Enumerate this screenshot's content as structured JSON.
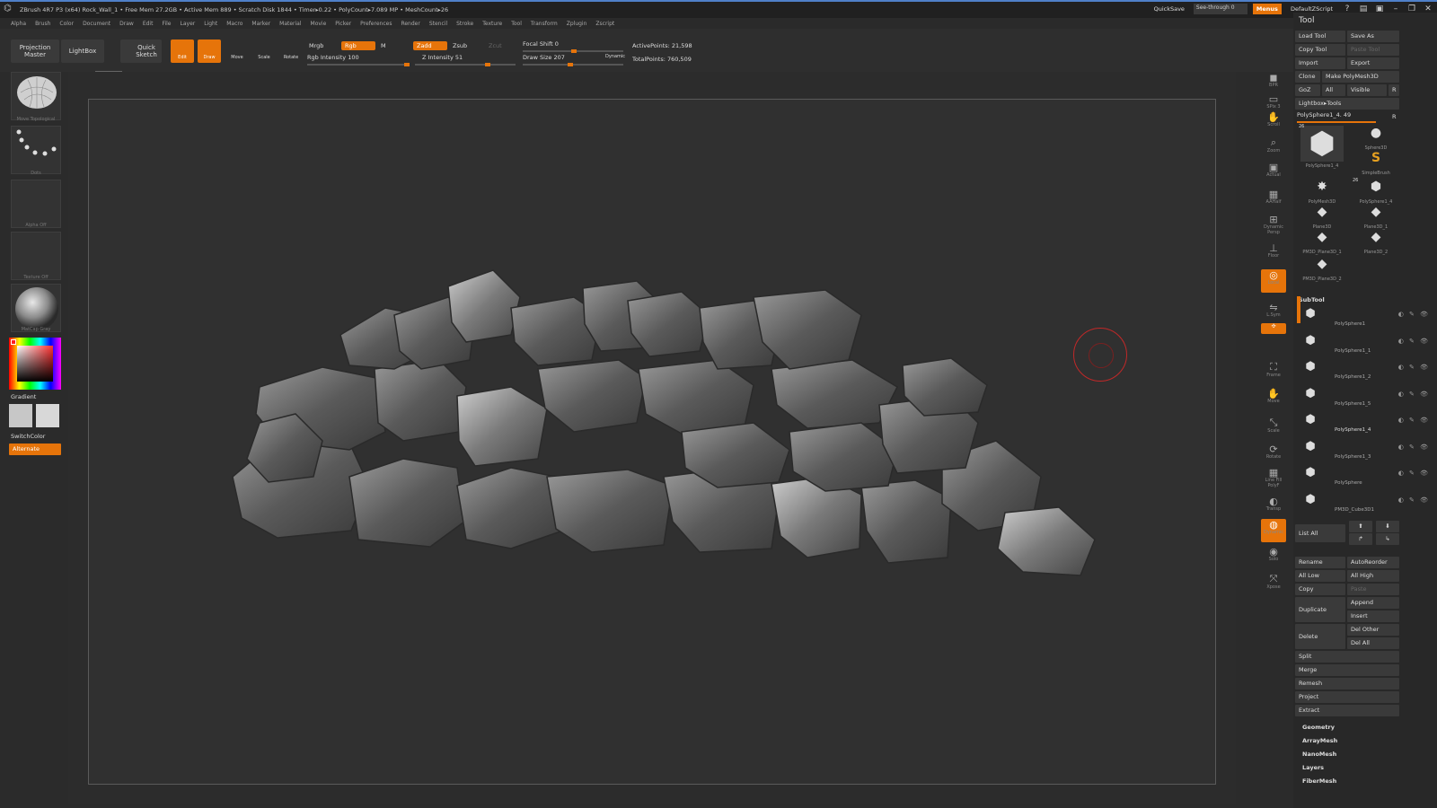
{
  "titlebar": {
    "logo_icon": "zbrush-logo-icon",
    "text": "ZBrush 4R7 P3 (x64)    Rock_Wall_1       • Free Mem 27.2GB • Active Mem 889 • Scratch Disk 1844 • Timer▸0.22 • PolyCount▸7.089 MP • MeshCount▸26",
    "quicksave": "QuickSave",
    "see_through": "See-through  0",
    "menus": "Menus",
    "default_zscript": "DefaultZScript"
  },
  "menus": [
    "Alpha",
    "Brush",
    "Color",
    "Document",
    "Draw",
    "Edit",
    "File",
    "Layer",
    "Light",
    "Macro",
    "Marker",
    "Material",
    "Movie",
    "Picker",
    "Preferences",
    "Render",
    "Stencil",
    "Stroke",
    "Texture",
    "Tool",
    "Transform",
    "Zplugin",
    "Zscript"
  ],
  "shelf": {
    "projection_master": "Projection Master",
    "lightbox": "LightBox",
    "quick_sketch": "Quick Sketch",
    "edit": "Edit",
    "draw": "Draw",
    "move": "Move",
    "scale": "Scale",
    "rotate": "Rotate",
    "mrgb": "Mrgb",
    "rgb": "Rgb",
    "m": "M",
    "rgb_intensity": "Rgb  Intensity 100",
    "zadd": "Zadd",
    "zsub": "Zsub",
    "zcut": "Zcut",
    "z_intensity": "Z  Intensity 51",
    "focal_shift": "Focal Shift 0",
    "draw_size": "Draw Size 207",
    "dynamic": "Dynamic",
    "active_points": "ActivePoints: 21,598",
    "total_points": "TotalPoints: 760,509",
    "rgb_intensity_value": 100,
    "z_intensity_value": 51,
    "draw_size_value": 207,
    "accent": "#e6740a"
  },
  "left_tray": {
    "brush_caption": "Move Topological",
    "stroke_caption": "Dots",
    "alpha_caption": "Alpha  Off",
    "texture_caption": "Texture  Off",
    "material_caption": "MatCap Gray",
    "gradient": "Gradient",
    "switch_color": "SwitchColor",
    "alternate": "Alternate"
  },
  "right_dock": [
    {
      "icon": "bpr-icon",
      "label": "BPR"
    },
    {
      "icon": "spix-icon",
      "label": "SPix 3"
    },
    {
      "icon": "scroll-icon",
      "label": "Scroll"
    },
    {
      "icon": "zoom-icon",
      "label": "Zoom"
    },
    {
      "icon": "actual-icon",
      "label": "Actual"
    },
    {
      "icon": "aahalf-icon",
      "label": "AAHalf"
    },
    {
      "icon": "persp-icon",
      "label": "Dynamic Persp"
    },
    {
      "icon": "floor-icon",
      "label": "Floor"
    },
    {
      "icon": "local-icon",
      "label": "Local"
    },
    {
      "icon": "lsym-icon",
      "label": "L.Sym"
    },
    {
      "icon": "xyz-icon",
      "label": "xyz"
    },
    {
      "icon": "frame-icon",
      "label": "Frame"
    },
    {
      "icon": "move-icon",
      "label": "Move"
    },
    {
      "icon": "scale-icon",
      "label": "Scale"
    },
    {
      "icon": "rotate-icon",
      "label": "Rotate"
    },
    {
      "icon": "polyf-icon",
      "label": "Line Fill PolyF"
    },
    {
      "icon": "transp-icon",
      "label": "Transp"
    },
    {
      "icon": "ghost-icon",
      "label": "Dynamic"
    },
    {
      "icon": "solo-icon",
      "label": "Solo"
    },
    {
      "icon": "xpose-icon",
      "label": "Xpose"
    }
  ],
  "tool_panel": {
    "title": "Tool",
    "load_tool": "Load Tool",
    "save_as": "Save As",
    "copy_tool": "Copy Tool",
    "paste_tool": "Paste Tool",
    "import": "Import",
    "export": "Export",
    "clone": "Clone",
    "make_polymesh": "Make PolyMesh3D",
    "goz": "GoZ",
    "all": "All",
    "visible": "Visible",
    "r": "R",
    "lightbox_tools": "Lightbox▸Tools",
    "current_tool": "PolySphere1_4. 49",
    "r2": "R",
    "tools": [
      {
        "icon": "rock-icon",
        "label": "PolySphere1_4",
        "count": "26"
      },
      {
        "icon": "sphere-icon",
        "label": "Sphere3D",
        "count": ""
      },
      {
        "icon": "simplebrush-icon",
        "label": "SimpleBrush",
        "count": ""
      },
      {
        "icon": "star-icon",
        "label": "PolyMesh3D",
        "count": ""
      },
      {
        "icon": "rock-icon",
        "label": "PolySphere1_4",
        "count": "26"
      },
      {
        "icon": "plane-icon",
        "label": "Plane3D",
        "count": ""
      },
      {
        "icon": "plane-icon",
        "label": "Plane3D_1",
        "count": ""
      },
      {
        "icon": "plane-icon",
        "label": "PM3D_Plane3D_1",
        "count": ""
      },
      {
        "icon": "plane-icon",
        "label": "Plane3D_2",
        "count": ""
      },
      {
        "icon": "plane-icon",
        "label": "PM3D_Plane3D_2",
        "count": ""
      }
    ],
    "subtool_title": "SubTool",
    "subtools": [
      {
        "name": "PolySphere1"
      },
      {
        "name": "PolySphere1_1"
      },
      {
        "name": "PolySphere1_2"
      },
      {
        "name": "PolySphere1_5"
      },
      {
        "name": "PolySphere1_4"
      },
      {
        "name": "PolySphere1_3"
      },
      {
        "name": "PolySphere"
      },
      {
        "name": "PM3D_Cube3D1"
      }
    ],
    "list_all": "List All",
    "rename": "Rename",
    "auto_reorder": "AutoReorder",
    "all_low": "All Low",
    "all_high": "All High",
    "copy": "Copy",
    "paste": "Paste",
    "duplicate": "Duplicate",
    "append": "Append",
    "insert": "Insert",
    "delete": "Delete",
    "del_other": "Del Other",
    "del_all": "Del All",
    "split": "Split",
    "merge": "Merge",
    "remesh": "Remesh",
    "project": "Project",
    "extract": "Extract",
    "sections": [
      "Geometry",
      "ArrayMesh",
      "NanoMesh",
      "Layers",
      "FiberMesh"
    ]
  }
}
